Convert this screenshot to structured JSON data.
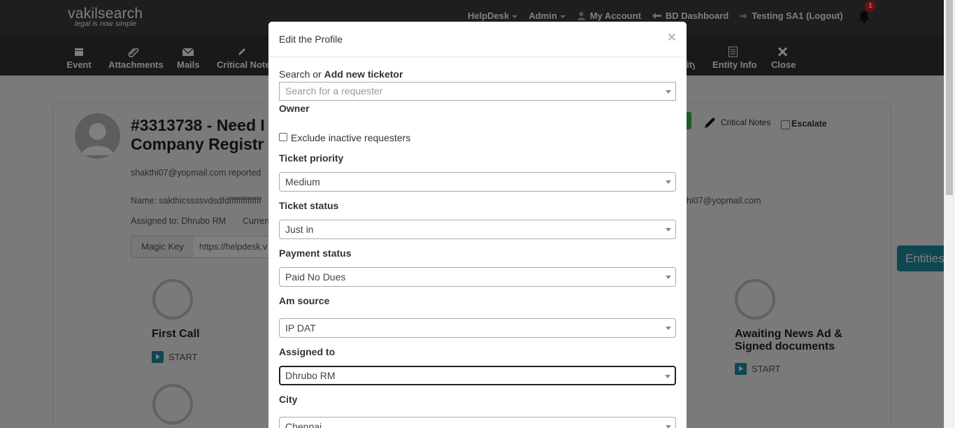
{
  "logo": {
    "brand_a": "vakil",
    "brand_b": "search",
    "tagline": "legal is now simple"
  },
  "topnav": {
    "helpdesk": "HelpDesk",
    "admin": "Admin",
    "my_account": "My Account",
    "bd_dashboard": "BD Dashboard",
    "logout": "Testing SA1 (Logout)",
    "notification_count": "1"
  },
  "toolbar": {
    "event": "Event",
    "attachments": "Attachments",
    "mails": "Mails",
    "critical_notes": "Critical Notes",
    "activity_partial": "ity",
    "entity_info": "Entity Info",
    "close": "Close"
  },
  "ticket": {
    "title_line1": "#3313738 - Need I",
    "title_line2": "Company Registr",
    "reported": "shakthi07@yopmail.com reported",
    "name": "Name: sakthicssssvdsdfdffffffffffffff",
    "email_partial": "hi07@yopmail.com",
    "assigned": "Assigned to: Dhrubo RM",
    "current_partial": "Curren",
    "magic_key_label": "Magic Key",
    "magic_key_value": "https://helpdesk.v",
    "critical_notes_link": "Critical Notes",
    "escalate": "Escalate",
    "entities_tab": "Entities"
  },
  "stages": [
    {
      "name": "First Call",
      "action": "START"
    },
    {
      "name": "Awaiting News Ad & Signed documents",
      "action": "START"
    }
  ],
  "modal": {
    "title": "Edit the Profile",
    "close_glyph": "×",
    "search_label_a": "Search or ",
    "search_label_b": "Add new ticketor",
    "search_placeholder": "Search for a requester",
    "owner_label": "Owner",
    "exclude_inactive": "Exclude inactive requesters",
    "priority_label": "Ticket priority",
    "priority_value": "Medium",
    "status_label": "Ticket status",
    "status_value": "Just in",
    "payment_label": "Payment status",
    "payment_value": "Paid No Dues",
    "am_source_label": "Am source",
    "am_source_value": "IP DAT",
    "assigned_label": "Assigned to",
    "assigned_value": "Dhrubo RM",
    "city_label": "City",
    "city_value": "Chennai"
  },
  "colors": {
    "accent": "#1c8ea5",
    "header": "#3c3c3c",
    "toolbar": "#333333",
    "badge": "#e31b23"
  }
}
